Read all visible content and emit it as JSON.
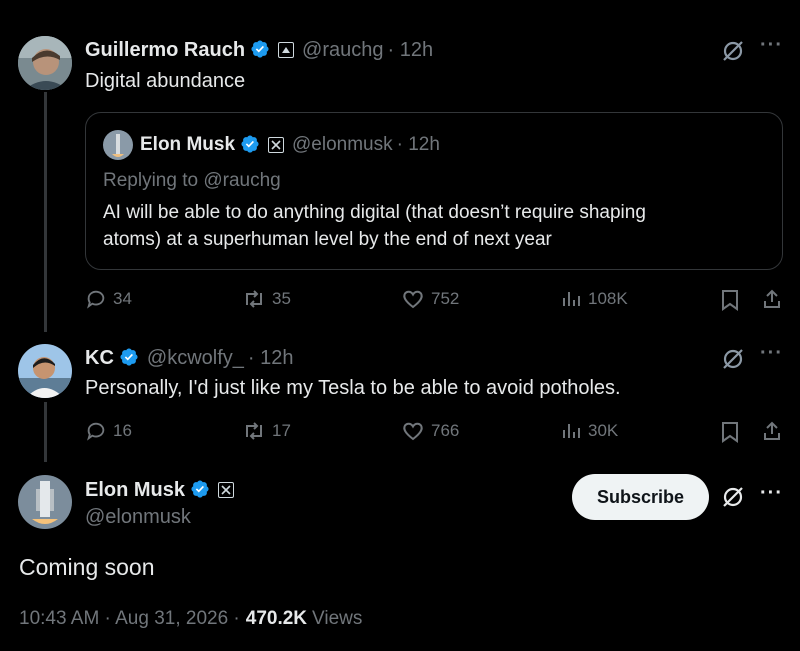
{
  "post1": {
    "name": "Guillermo Rauch",
    "handle": "@rauchg",
    "time": "· 12h",
    "text": "Digital abundance",
    "quote": {
      "name": "Elon Musk",
      "handle": "@elonmusk",
      "time": "· 12h",
      "replying": "Replying to @rauchg",
      "text_line1": "AI will be able to do anything digital (that doesn’t require shaping",
      "text_line2": "atoms) at a superhuman level by the end of next year"
    },
    "stats": {
      "replies": "34",
      "reposts": "35",
      "likes": "752",
      "views": "108K"
    }
  },
  "post2": {
    "name": "KC",
    "handle": "@kcwolfy_",
    "time": "· 12h",
    "text": "Personally, I'd just like my Tesla to be able to avoid potholes.",
    "stats": {
      "replies": "16",
      "reposts": "17",
      "likes": "766",
      "views": "30K"
    }
  },
  "main_post": {
    "name": "Elon Musk",
    "handle": "@elonmusk",
    "subscribe_label": "Subscribe",
    "text": "Coming soon",
    "timestamp": "10:43 AM · Aug 31, 2026 ·",
    "view_count": "470.2K",
    "views_label": "Views"
  },
  "icons": {
    "verified": "verified-badge-icon",
    "more": "more-icon",
    "grok": "grok-icon",
    "reply": "reply-icon",
    "repost": "repost-icon",
    "like": "like-icon",
    "views": "views-icon",
    "bookmark": "bookmark-icon",
    "share": "share-icon"
  },
  "colors": {
    "background": "#000000",
    "text": "#e7e9ea",
    "muted": "#71767b",
    "verified": "#1d9bf0"
  }
}
